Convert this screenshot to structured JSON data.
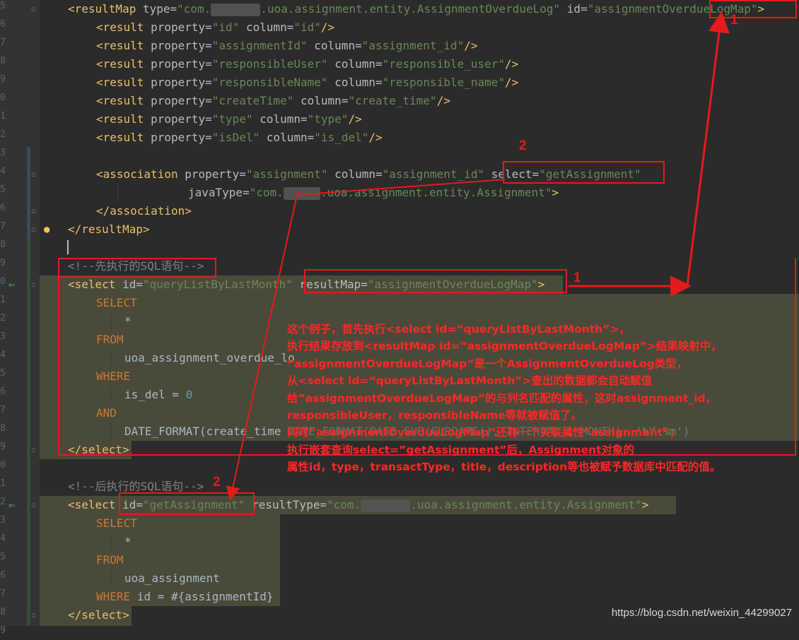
{
  "gutter": {
    "line_numbers": [
      "5",
      "6",
      "7",
      "8",
      "9",
      "0",
      "1",
      "2",
      "3",
      "4",
      "5",
      "6",
      "7",
      "8",
      "9",
      "0",
      "1",
      "2",
      "3",
      "4",
      "5",
      "6",
      "7",
      "8",
      "9",
      "0",
      "1",
      "2",
      "3",
      "4",
      "5",
      "6",
      "7",
      "8",
      "9"
    ]
  },
  "code": {
    "l1_tag_open": "<resultMap",
    "l1_attr_type": "type",
    "l1_type_prefix": "\"com.",
    "l1_type_suffix": ".uoa.assignment.entity.AssignmentOverdueLog\"",
    "l1_attr_id": "id",
    "l1_id_val": "\"assignmentOverdueLogMap\"",
    "l1_close": ">",
    "results": [
      {
        "prop": "\"id\"",
        "col": "\"id\""
      },
      {
        "prop": "\"assignmentId\"",
        "col": "\"assignment_id\""
      },
      {
        "prop": "\"responsibleUser\"",
        "col": "\"responsible_user\""
      },
      {
        "prop": "\"responsibleName\"",
        "col": "\"responsible_name\""
      },
      {
        "prop": "\"createTime\"",
        "col": "\"create_time\""
      },
      {
        "prop": "\"type\"",
        "col": "\"type\""
      },
      {
        "prop": "\"isDel\"",
        "col": "\"is_del\""
      }
    ],
    "result_tag": "<result",
    "property_attr": "property",
    "column_attr": "column",
    "self_close": "/>",
    "assoc_open": "<association",
    "assoc_prop": "\"assignment\"",
    "assoc_col": "\"assignment_id\"",
    "select_attr": "select",
    "assoc_select": "\"getAssignment\"",
    "javatype_attr": "javaType",
    "javatype_prefix": "\"com.",
    "javatype_suffix": ".uoa.assignment.entity.Assignment\"",
    "assoc_close": "</association>",
    "resultmap_close": "</resultMap>",
    "comment1": "<!--先执行的SQL语句-->",
    "select1_open": "<select",
    "id_attr": "id",
    "select1_id": "\"queryListByLastMonth\"",
    "resultmap_attr": "resultMap",
    "select1_rm": "\"assignmentOverdueLogMap\"",
    "kw_select": "SELECT",
    "star": "*",
    "kw_from": "FROM",
    "table1": "uoa_assignment_overdue_lo",
    "kw_where": "WHERE",
    "where1_col": "is_del = ",
    "where1_val": "0",
    "kw_and": "AND",
    "datefmt_start": "DATE_FORMAT(create_time",
    "datefmt_mid": "DATE_FORMAT(DATE_SUB(CURDATE(), INTERVAL 1 MONTH),",
    "datefmt_end": "'%Y-%m')",
    "select_close": "</select>",
    "comment2": "<!--后执行的SQL语句-->",
    "select2_id": "\"getAssignment\"",
    "resulttype_attr": "resultType",
    "select2_type_prefix": "\"com.",
    "select2_type_suffix": ".uoa.assignment.entity.Assignment\"",
    "table2": "uoa_assignment",
    "where2": "id = #{assignmentId}"
  },
  "annotations": {
    "label_1a": "1",
    "label_1b": "1",
    "label_2a": "2",
    "label_2b": "2",
    "note_lines": [
      "这个例子，首先执行<select id=“queryListByLastMonth”>，",
      "执行结果存放到<resultMap id=”assignmentOverdueLogMap”>结果映射中，",
      "“assignmentOverdueLogMap”是一个AssignmentOverdueLog类型，",
      "从<select id=“queryListByLastMonth”>查出的数据都会自动赋值",
      "给”assignmentOverdueLogMap”的与列名匹配的属性，这时assignment_id，",
      "responsibleUser，responsibleName等就被赋值了。",
      "同时”assignmentOverdueLogMap”还有一个关联属性”assignment”，",
      "执行嵌套查询select=”getAssignment”后，Assignment对象的",
      "属性id，type，transactType，title，description等也被赋予数据库中匹配的值。"
    ],
    "color": "#e31b1b"
  },
  "watermark": "https://blog.csdn.net/weixin_44299027"
}
